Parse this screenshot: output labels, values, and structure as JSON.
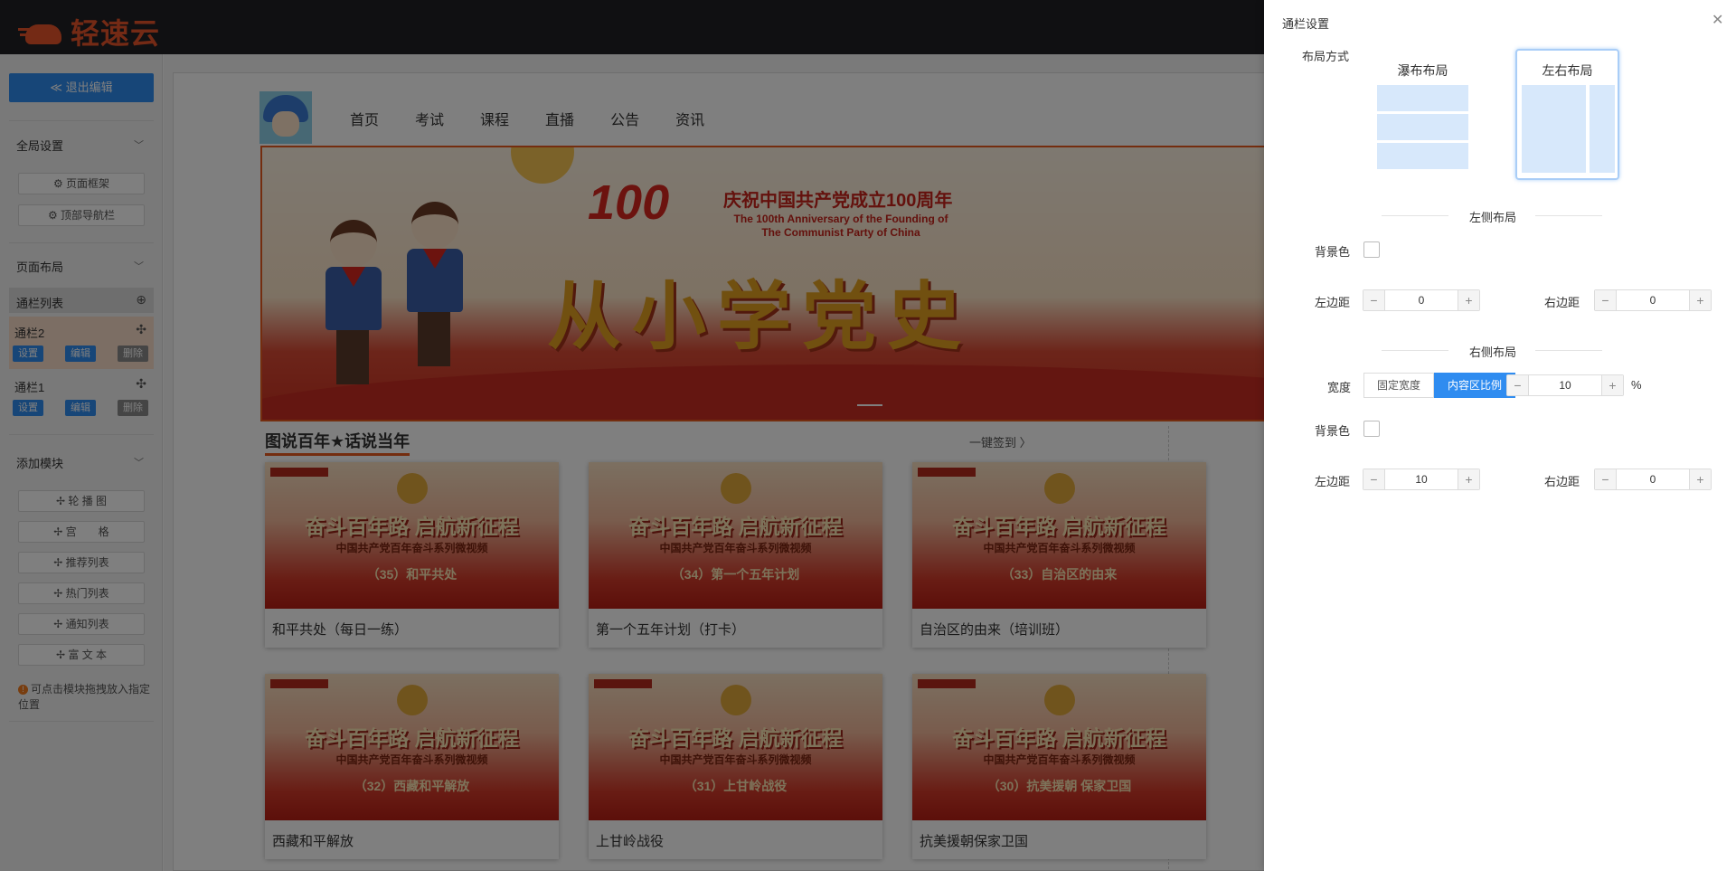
{
  "app": {
    "logo_text": "轻速云"
  },
  "sidebar": {
    "exit_label": "≪ 退出编辑",
    "global_settings": "全局设置",
    "page_frame": "⚙ 页面框架",
    "top_nav": "⚙ 顶部导航栏",
    "page_layout": "页面布局",
    "column_list": "通栏列表",
    "columns": [
      {
        "name": "通栏2",
        "settings": "设置",
        "edit": "编辑",
        "delete": "删除"
      },
      {
        "name": "通栏1",
        "settings": "设置",
        "edit": "编辑",
        "delete": "删除"
      }
    ],
    "add_module": "添加模块",
    "modules": [
      "✢ 轮 播 图",
      "✢ 宫　　格",
      "✢ 推荐列表",
      "✢ 热门列表",
      "✢ 通知列表",
      "✢ 富 文 本"
    ],
    "tip": "可点击模块拖拽放入指定位置"
  },
  "site": {
    "nav": [
      "首页",
      "考试",
      "课程",
      "直播",
      "公告",
      "资讯"
    ],
    "banner": {
      "badge": "100",
      "title": "庆祝中国共产党成立100周年",
      "subtitle": "The 100th Anniversary of the Founding of The Communist Party of China",
      "headline": "从小学党史"
    },
    "section_title": "图说百年★话说当年",
    "section_more": "一键签到 〉",
    "cards": [
      {
        "heading": "奋斗百年路 启航新征程",
        "sub": "中国共产党百年奋斗系列微视频",
        "episode": "（35）和平共处",
        "caption": "和平共处（每日一练）"
      },
      {
        "heading": "奋斗百年路 启航新征程",
        "sub": "中国共产党百年奋斗系列微视频",
        "episode": "（34）第一个五年计划",
        "caption": "第一个五年计划（打卡）"
      },
      {
        "heading": "奋斗百年路 启航新征程",
        "sub": "中国共产党百年奋斗系列微视频",
        "episode": "（33）自治区的由来",
        "caption": "自治区的由来（培训班）"
      },
      {
        "heading": "奋斗百年路 启航新征程",
        "sub": "中国共产党百年奋斗系列微视频",
        "episode": "（32）西藏和平解放",
        "caption": "西藏和平解放"
      },
      {
        "heading": "奋斗百年路 启航新征程",
        "sub": "中国共产党百年奋斗系列微视频",
        "episode": "（31）上甘岭战役",
        "caption": "上甘岭战役"
      },
      {
        "heading": "奋斗百年路 启航新征程",
        "sub": "中国共产党百年奋斗系列微视频",
        "episode": "（30）抗美援朝 保家卫国",
        "caption": "抗美援朝保家卫国"
      }
    ]
  },
  "drawer": {
    "title": "通栏设置",
    "close": "✕",
    "layout_label": "布局方式",
    "layout_options": [
      "瀑布布局",
      "左右布局"
    ],
    "layout_selected": "左右布局",
    "left_section": "左侧布局",
    "right_section": "右侧布局",
    "bg_label": "背景色",
    "left_margin_label": "左边距",
    "right_margin_label": "右边距",
    "width_label": "宽度",
    "width_modes": [
      "固定宽度",
      "内容区比例"
    ],
    "width_mode_selected": "内容区比例",
    "percent_unit": "%",
    "left": {
      "left_margin": "0",
      "right_margin": "0"
    },
    "right": {
      "width_value": "10",
      "left_margin": "10",
      "right_margin": "0"
    },
    "minus": "−",
    "plus": "+"
  }
}
